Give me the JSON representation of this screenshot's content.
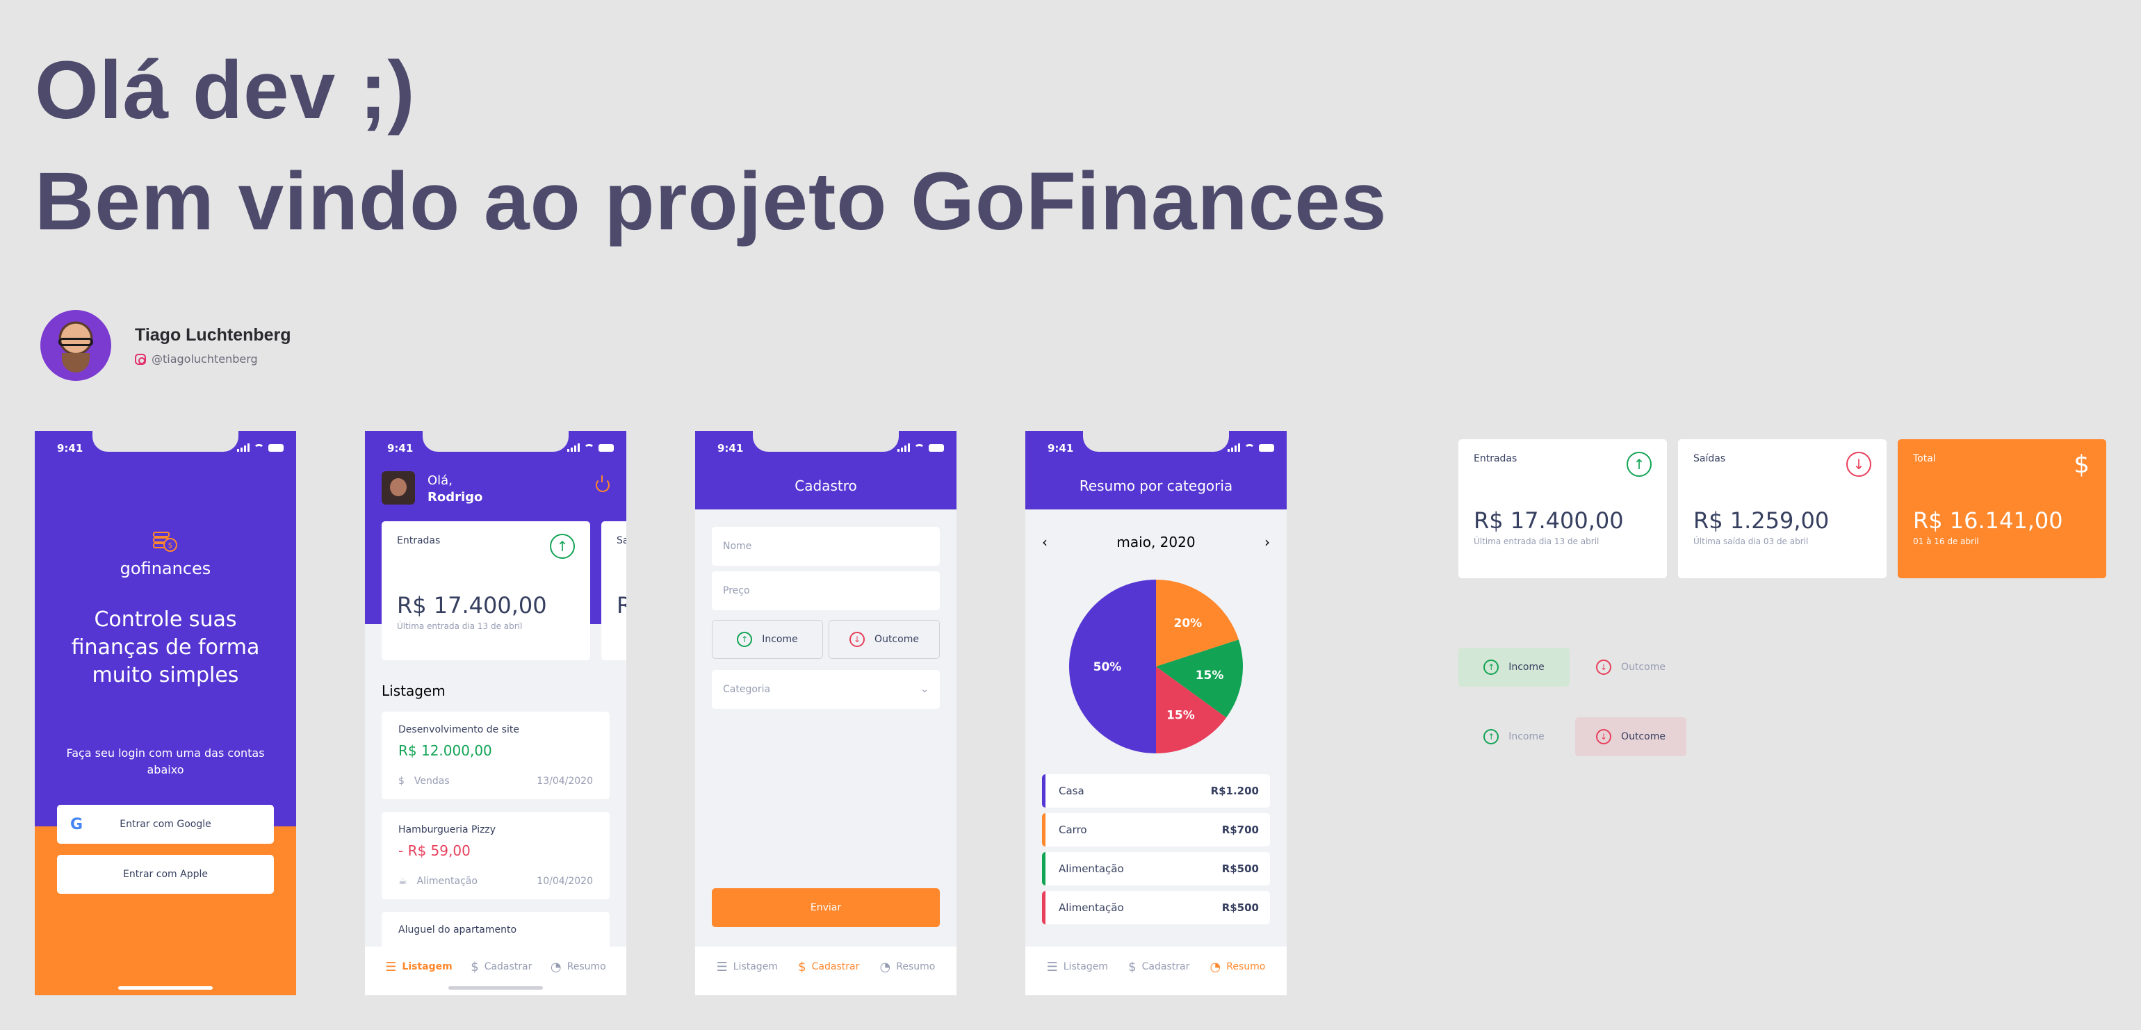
{
  "hero": {
    "line1": "Olá dev ;)",
    "line2": "Bem vindo ao projeto GoFinances"
  },
  "author": {
    "name": "Tiago Luchtenberg",
    "handle": "@tiagoluchtenberg",
    "icon": "instagram-icon"
  },
  "colors": {
    "primary": "#5636d3",
    "secondary": "#ff872c",
    "success": "#12a454",
    "attention": "#e83f5b",
    "background": "#f0f2f5",
    "text": "#969cb2",
    "title": "#363f5f"
  },
  "status_time": "9:41",
  "login": {
    "logo_text": "gofinances",
    "headline": "Controle suas finanças de forma muito simples",
    "subtitle": "Faça seu login com uma das contas abaixo",
    "google": "Entrar com Google",
    "apple": "Entrar com Apple"
  },
  "dashboard": {
    "greet": "Olá,",
    "user": "Rodrigo",
    "card1": {
      "title": "Entradas",
      "amount": "R$ 17.400,00",
      "last": "Última entrada dia 13 de abril"
    },
    "card2": {
      "title": "Sa",
      "amount": "R"
    },
    "list_title": "Listagem",
    "transactions": [
      {
        "name": "Desenvolvimento de site",
        "amount": "R$ 12.000,00",
        "category": "Vendas",
        "date": "13/04/2020"
      },
      {
        "name": "Hamburgueria Pizzy",
        "amount": "- R$ 59,00",
        "category": "Alimentação",
        "date": "10/04/2020"
      },
      {
        "name": "Aluguel do apartamento"
      }
    ]
  },
  "tabs": {
    "listagem": "Listagem",
    "cadastrar": "Cadastrar",
    "resumo": "Resumo"
  },
  "register": {
    "title": "Cadastro",
    "name_placeholder": "Nome",
    "price_placeholder": "Preço",
    "income": "Income",
    "outcome": "Outcome",
    "category_placeholder": "Categoria",
    "send": "Enviar"
  },
  "resume": {
    "title": "Resumo por categoria",
    "month": "maio, 2020",
    "legend": [
      {
        "name": "Casa",
        "amount": "R$1.200",
        "color": "#5636d3"
      },
      {
        "name": "Carro",
        "amount": "R$700",
        "color": "#ff872c"
      },
      {
        "name": "Alimentação",
        "amount": "R$500",
        "color": "#12a454"
      },
      {
        "name": "Alimentação",
        "amount": "R$500",
        "color": "#e83f5b"
      }
    ],
    "pie": [
      {
        "label": "50%",
        "value": 50,
        "color": "#5636d3"
      },
      {
        "label": "20%",
        "value": 20,
        "color": "#ff872c"
      },
      {
        "label": "15%",
        "value": 15,
        "color": "#12a454"
      },
      {
        "label": "15%",
        "value": 15,
        "color": "#e83f5b"
      }
    ]
  },
  "components": {
    "entradas": {
      "title": "Entradas",
      "amount": "R$ 17.400,00",
      "last": "Última entrada dia 13 de abril"
    },
    "saidas": {
      "title": "Saídas",
      "amount": "R$ 1.259,00",
      "last": "Última saída dia 03 de abril"
    },
    "total": {
      "title": "Total",
      "amount": "R$ 16.141,00",
      "last": "01 à 16 de abril"
    },
    "income": "Income",
    "outcome": "Outcome"
  }
}
